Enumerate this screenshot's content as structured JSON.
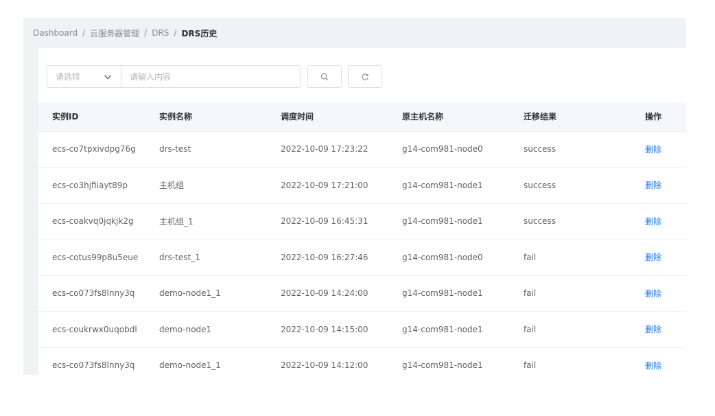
{
  "breadcrumb": [
    "Dashboard",
    "云服务器管理",
    "DRS",
    "DRS历史"
  ],
  "breadcrumb_separator": "/",
  "filter": {
    "select_placeholder": "请选择",
    "search_placeholder": "请输入内容"
  },
  "table": {
    "headers": [
      "实例ID",
      "实例名称",
      "调度时间",
      "原主机名称",
      "迁移结果",
      "操作"
    ],
    "rows": [
      {
        "id": "ecs-co7tpxivdpg76g",
        "name": "drs-test",
        "time": "2022-10-09 17:23:22",
        "host": "g14-com981-node0",
        "result": "success",
        "action": "删除"
      },
      {
        "id": "ecs-co3hjfiiayt89p",
        "name": "主机组",
        "time": "2022-10-09 17:21:00",
        "host": "g14-com981-node1",
        "result": "success",
        "action": "删除"
      },
      {
        "id": "ecs-coakvq0jqkjk2g",
        "name": "主机组_1",
        "time": "2022-10-09 16:45:31",
        "host": "g14-com981-node1",
        "result": "success",
        "action": "删除"
      },
      {
        "id": "ecs-cotus99p8u5eue",
        "name": "drs-test_1",
        "time": "2022-10-09 16:27:46",
        "host": "g14-com981-node0",
        "result": "fail",
        "action": "删除"
      },
      {
        "id": "ecs-co073fs8lnny3q",
        "name": "demo-node1_1",
        "time": "2022-10-09 14:24:00",
        "host": "g14-com981-node1",
        "result": "fail",
        "action": "删除"
      },
      {
        "id": "ecs-coukrwx0uqobdl",
        "name": "demo-node1",
        "time": "2022-10-09 14:15:00",
        "host": "g14-com981-node1",
        "result": "fail",
        "action": "删除"
      },
      {
        "id": "ecs-co073fs8lnny3q",
        "name": "demo-node1_1",
        "time": "2022-10-09 14:12:00",
        "host": "g14-com981-node1",
        "result": "fail",
        "action": "删除"
      }
    ]
  },
  "colors": {
    "link": "#1677ff",
    "header_bg": "#f5f7fa",
    "page_bg": "#f0f2f5"
  }
}
